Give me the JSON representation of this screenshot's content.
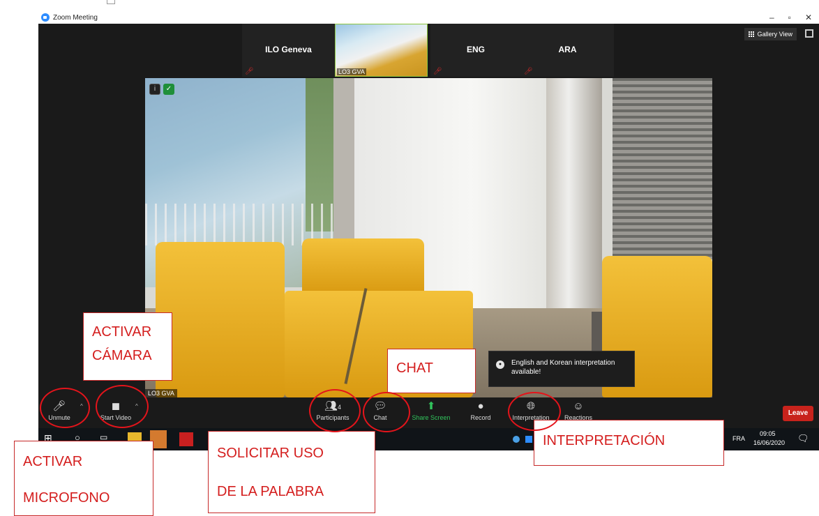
{
  "window": {
    "title": "Zoom Meeting",
    "minimize": "–",
    "maximize": "▫",
    "close": "✕"
  },
  "top_strip": {
    "thumbnails": [
      {
        "label": "ILO Geneva",
        "muted": true
      },
      {
        "label": "LO3 GVA",
        "active": true,
        "muted": true
      },
      {
        "label": "ENG",
        "muted": true
      },
      {
        "label": "ARA",
        "muted": true
      }
    ],
    "gallery_view_label": "Gallery View"
  },
  "main_video": {
    "participant_name": "LO3 GVA"
  },
  "toast": {
    "text": "English and Korean interpretation available!"
  },
  "toolbar": {
    "unmute_label": "Unmute",
    "start_video_label": "Start Video",
    "participants_label": "Participants",
    "participants_count": "4",
    "chat_label": "Chat",
    "share_screen_label": "Share Screen",
    "record_label": "Record",
    "interpretation_label": "Interpretation",
    "reactions_label": "Reactions",
    "leave_label": "Leave"
  },
  "taskbar": {
    "language": "FRA",
    "time": "09:05",
    "date": "16/06/2020"
  },
  "annotations": {
    "activar_camara_line1": "ACTIVAR",
    "activar_camara_line2": "CÁMARA",
    "chat": "CHAT",
    "interpretacion": "INTERPRETACIÓN",
    "activar_microfono_line1": "ACTIVAR",
    "activar_microfono_line2": "MICROFONO",
    "solicitar_line1": "SOLICITAR USO",
    "solicitar_line2": "DE LA PALABRA"
  },
  "colors": {
    "annotation_red": "#d41e1e",
    "leave_red": "#c8231c",
    "share_green": "#31c45c",
    "zoom_blue": "#2d8cff"
  }
}
